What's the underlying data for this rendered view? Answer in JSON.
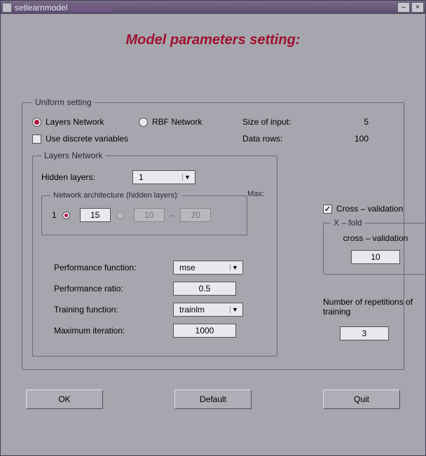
{
  "window": {
    "title": "setlearnmodel",
    "min_icon": "–",
    "close_icon": "×"
  },
  "heading": "Model parameters setting:",
  "uniform": {
    "legend": "Uniform setting",
    "radio_layers": "Layers Network",
    "radio_rbf": "RBF Network",
    "use_discrete": "Use discrete variables",
    "size_of_input_label": "Size of input:",
    "size_of_input_value": "5",
    "data_rows_label": "Data rows:",
    "data_rows_value": "100"
  },
  "layers": {
    "legend": "Layers Network",
    "hidden_layers_label": "Hidden layers:",
    "hidden_layers_value": "1",
    "arch_legend": "Network architecture (hidden layers):",
    "max_label": "Max:",
    "one_label": "1",
    "arch_val1": "15",
    "arch_val2": "10",
    "arch_val3": "20"
  },
  "perf": {
    "perf_func_label": "Performance function:",
    "perf_func_value": "mse",
    "perf_ratio_label": "Performance ratio:",
    "perf_ratio_value": "0.5",
    "train_func_label": "Training function:",
    "train_func_value": "trainlm",
    "max_iter_label": "Maximum iteration:",
    "max_iter_value": "1000"
  },
  "cv": {
    "checkbox_label": "Cross – validation",
    "xfold_legend": "X – fold",
    "xfold_body": "cross – validation",
    "xfold_value": "10",
    "reps_label": "Number of repetitions of training",
    "reps_value": "3"
  },
  "buttons": {
    "ok": "OK",
    "default": "Default",
    "quit": "Quit"
  }
}
